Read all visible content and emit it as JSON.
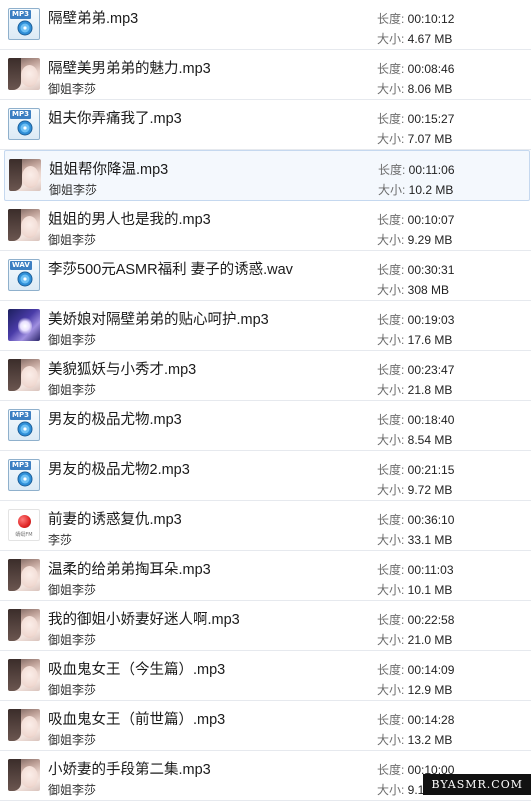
{
  "labels": {
    "length": "长度: ",
    "size": "大小: "
  },
  "tracks": [
    {
      "title": "隔壁弟弟.mp3",
      "artist": "",
      "length": "00:10:12",
      "size": "4.67 MB",
      "icon": "mp3-file-icon",
      "ext": "MP3"
    },
    {
      "title": "隔壁美男弟弟的魅力.mp3",
      "artist": "御姐李莎",
      "length": "00:08:46",
      "size": "8.06 MB",
      "icon": "avatar-photo"
    },
    {
      "title": "姐夫你弄痛我了.mp3",
      "artist": "",
      "length": "00:15:27",
      "size": "7.07 MB",
      "icon": "mp3-file-icon",
      "ext": "MP3"
    },
    {
      "title": "姐姐帮你降温.mp3",
      "artist": "御姐李莎",
      "length": "00:11:06",
      "size": "10.2 MB",
      "icon": "avatar-photo",
      "selected": true
    },
    {
      "title": "姐姐的男人也是我的.mp3",
      "artist": "御姐李莎",
      "length": "00:10:07",
      "size": "9.29 MB",
      "icon": "avatar-photo"
    },
    {
      "title": "李莎500元ASMR福利 妻子的诱惑.wav",
      "artist": "",
      "length": "00:30:31",
      "size": "308 MB",
      "icon": "wav-file-icon",
      "ext": "WAV"
    },
    {
      "title": "美娇娘对隔壁弟弟的贴心呵护.mp3",
      "artist": "御姐李莎",
      "length": "00:19:03",
      "size": "17.6 MB",
      "icon": "avatar-anime"
    },
    {
      "title": "美貌狐妖与小秀才.mp3",
      "artist": "御姐李莎",
      "length": "00:23:47",
      "size": "21.8 MB",
      "icon": "avatar-photo"
    },
    {
      "title": "男友的极品尤物.mp3",
      "artist": "",
      "length": "00:18:40",
      "size": "8.54 MB",
      "icon": "mp3-file-icon",
      "ext": "MP3"
    },
    {
      "title": "男友的极品尤物2.mp3",
      "artist": "",
      "length": "00:21:15",
      "size": "9.72 MB",
      "icon": "mp3-file-icon",
      "ext": "MP3"
    },
    {
      "title": "前妻的诱惑复仇.mp3",
      "artist": "李莎",
      "length": "00:36:10",
      "size": "33.1 MB",
      "icon": "radio-app-icon",
      "logo_text": "蜻蜓FM"
    },
    {
      "title": "温柔的给弟弟掏耳朵.mp3",
      "artist": "御姐李莎",
      "length": "00:11:03",
      "size": "10.1 MB",
      "icon": "avatar-photo"
    },
    {
      "title": "我的御姐小娇妻好迷人啊.mp3",
      "artist": "御姐李莎",
      "length": "00:22:58",
      "size": "21.0 MB",
      "icon": "avatar-photo"
    },
    {
      "title": "吸血鬼女王（今生篇）.mp3",
      "artist": "御姐李莎",
      "length": "00:14:09",
      "size": "12.9 MB",
      "icon": "avatar-photo"
    },
    {
      "title": "吸血鬼女王（前世篇）.mp3",
      "artist": "御姐李莎",
      "length": "00:14:28",
      "size": "13.2 MB",
      "icon": "avatar-photo"
    },
    {
      "title": "小娇妻的手段第二集.mp3",
      "artist": "御姐李莎",
      "length": "00:10:00",
      "size": "9.19 MB",
      "icon": "avatar-photo"
    }
  ],
  "watermark": "BYASMR.COM"
}
